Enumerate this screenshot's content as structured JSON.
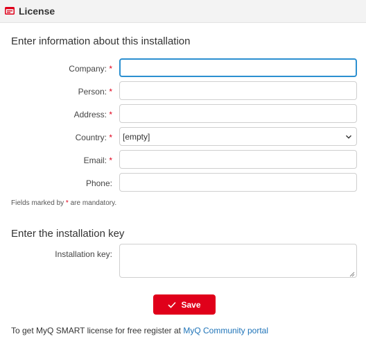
{
  "header": {
    "title": "License",
    "icon": "license-card-icon",
    "icon_color": "#e0001a"
  },
  "installation_info": {
    "heading": "Enter information about this installation",
    "required_marker": "*",
    "fields": {
      "company": {
        "label": "Company:",
        "value": ""
      },
      "person": {
        "label": "Person:",
        "value": ""
      },
      "address": {
        "label": "Address:",
        "value": ""
      },
      "country": {
        "label": "Country:",
        "selected": "[empty]"
      },
      "email": {
        "label": "Email:",
        "value": ""
      },
      "phone": {
        "label": "Phone:",
        "value": ""
      }
    },
    "mandatory_note_prefix": "Fields marked by",
    "mandatory_note_suffix": "are mandatory."
  },
  "installation_key": {
    "heading": "Enter the installation key",
    "label": "Installation key:",
    "value": ""
  },
  "actions": {
    "save_label": "Save",
    "save_color": "#e0001a"
  },
  "footer": {
    "text": "To get MyQ SMART license for free register at",
    "link_text": "MyQ Community portal",
    "link_color": "#1e73b8"
  },
  "colors": {
    "accent": "#e0001a",
    "focus": "#2b8fd0"
  }
}
